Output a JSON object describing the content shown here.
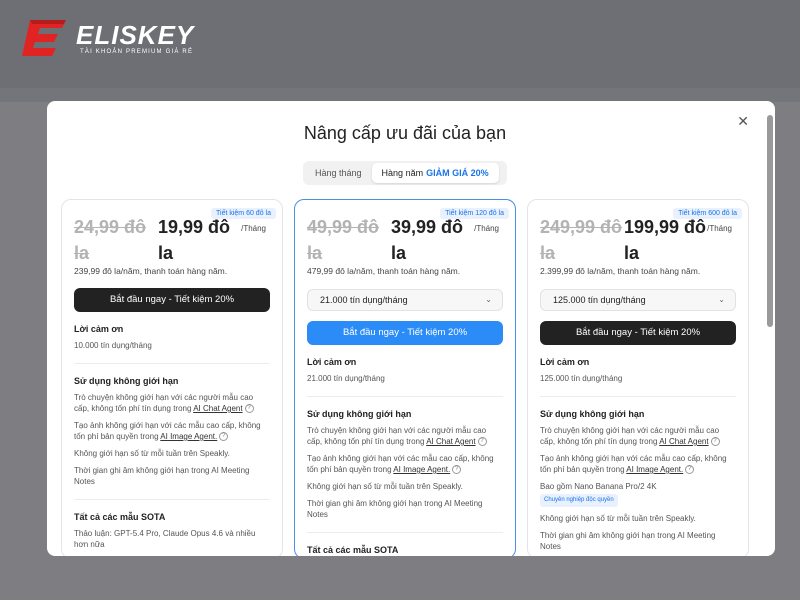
{
  "brand": {
    "name": "ELISKEY",
    "tagline": "TÀI KHOẢN PREMIUM GIÁ RẺ",
    "accent": "#e02424"
  },
  "modal": {
    "title": "Nâng cấp ưu đãi của bạn",
    "close_icon": "close-icon",
    "toggle": {
      "monthly": "Hàng tháng",
      "yearly": "Hàng năm",
      "discount": "GIẢM GIÁ 20%"
    }
  },
  "plans": [
    {
      "badge": "Tiết kiệm 60 đô la",
      "old_price": "24,99 đô la",
      "new_price": "19,99 đô la",
      "per": "/Tháng",
      "yearly": "239,99 đô la/năm, thanh toán hàng năm.",
      "cta": "Bắt đầu ngay - Tiết kiệm 20%",
      "credits_title": "Lời cảm ơn",
      "credits_text": "10.000 tín dụng/tháng",
      "unlimited_title": "Sử dụng không giới hạn",
      "f1_pre": "Trò chuyện không giới hạn với các người mẫu cao cấp, không tốn phí tín dụng trong ",
      "f1_link": "AI Chat Agent",
      "f2_pre": "Tạo ảnh không giới hạn với các mẫu cao cấp, không tốn phí bản quyền trong ",
      "f2_link": "AI Image Agent.",
      "f3": "Không giới hạn số từ mỗi tuần trên Speakly.",
      "f4": "Thời gian ghi âm không giới hạn trong AI Meeting Notes",
      "sota_title": "Tất cả các mẫu SOTA",
      "sota_text": "Thảo luận: GPT-5.4 Pro, Claude Opus 4.6 và nhiều hơn nữa"
    },
    {
      "badge": "Tiết kiệm 120 đô la",
      "old_price": "49,99 đô la",
      "new_price": "39,99 đô la",
      "per": "/Tháng",
      "yearly": "479,99 đô la/năm, thanh toán hàng năm.",
      "select": "21.000 tín dụng/tháng",
      "cta": "Bắt đầu ngay - Tiết kiệm 20%",
      "credits_title": "Lời cảm ơn",
      "credits_text": "21.000 tín dụng/tháng",
      "unlimited_title": "Sử dụng không giới hạn",
      "f1_pre": "Trò chuyện không giới hạn với các người mẫu cao cấp, không tốn phí tín dụng trong ",
      "f1_link": "AI Chat Agent",
      "f2_pre": "Tạo ảnh không giới hạn với các mẫu cao cấp, không tốn phí bản quyền trong ",
      "f2_link": "AI Image Agent.",
      "f3": "Không giới hạn số từ mỗi tuần trên Speakly.",
      "f4": "Thời gian ghi âm không giới hạn trong AI Meeting Notes",
      "sota_title": "Tất cả các mẫu SOTA"
    },
    {
      "badge": "Tiết kiệm 600 đô la",
      "old_price": "249,99 đô la",
      "new_price": "199,99 đô la",
      "per": "/Tháng",
      "yearly": "2.399,99 đô la/năm, thanh toán hàng năm.",
      "select": "125.000 tín dụng/tháng",
      "cta": "Bắt đầu ngay - Tiết kiệm 20%",
      "credits_title": "Lời cảm ơn",
      "credits_text": "125.000 tín dụng/tháng",
      "unlimited_title": "Sử dụng không giới hạn",
      "f1_pre": "Trò chuyện không giới hạn với các người mẫu cao cấp, không tốn phí tín dụng trong ",
      "f1_link": "AI Chat Agent",
      "f2_pre": "Tạo ảnh không giới hạn với các mẫu cao cấp, không tốn phí bản quyền trong ",
      "f2_link": "AI Image Agent.",
      "f_extra": "Bao gồm Nano Banana Pro/2 4K",
      "f_extra_tag": "Chuyên nghiệp độc quyền",
      "f3": "Không giới hạn số từ mỗi tuần trên Speakly.",
      "f4": "Thời gian ghi âm không giới hạn trong AI Meeting Notes"
    }
  ]
}
